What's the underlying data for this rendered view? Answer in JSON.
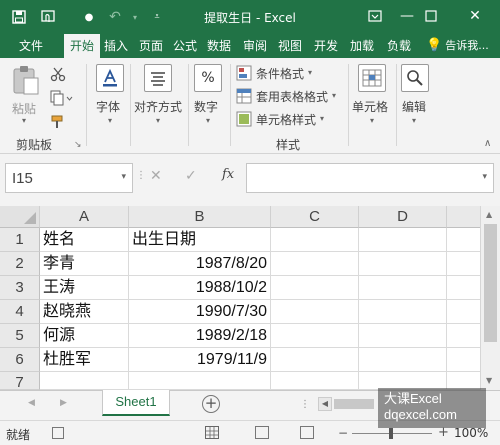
{
  "window": {
    "title": "提取生日 - Excel"
  },
  "ribbon_tabs": [
    "文件",
    "开始",
    "插入",
    "页面",
    "公式",
    "数据",
    "审阅",
    "视图",
    "开发",
    "加载",
    "负载",
    "告诉我..."
  ],
  "active_tab": "开始",
  "ribbon": {
    "paste_label": "粘贴",
    "clipboard_group": "剪贴板",
    "font_label": "字体",
    "align_label": "对齐方式",
    "number_label": "数字",
    "conditional_format": "条件格式",
    "table_format": "套用表格格式",
    "cell_style": "单元格样式",
    "styles_group": "样式",
    "cells_label": "单元格",
    "editing_label": "编辑"
  },
  "formula_bar": {
    "name_box": "I15",
    "fx": "fx",
    "formula": ""
  },
  "columns": [
    "A",
    "B",
    "C",
    "D"
  ],
  "rows": [
    {
      "num": "1",
      "a": "姓名",
      "b": "出生日期"
    },
    {
      "num": "2",
      "a": "李青",
      "b": "1987/8/20"
    },
    {
      "num": "3",
      "a": "王涛",
      "b": "1988/10/2"
    },
    {
      "num": "4",
      "a": "赵晓燕",
      "b": "1990/7/30"
    },
    {
      "num": "5",
      "a": "何源",
      "b": "1989/2/18"
    },
    {
      "num": "6",
      "a": "杜胜军",
      "b": "1979/11/9"
    },
    {
      "num": "7",
      "a": "",
      "b": ""
    }
  ],
  "sheet_tabs": [
    "Sheet1"
  ],
  "status": {
    "ready": "就绪",
    "zoom": "100%"
  },
  "watermark": {
    "line1": "大课Excel",
    "line2": "dqexcel.com"
  },
  "colors": {
    "accent": "#217346"
  }
}
